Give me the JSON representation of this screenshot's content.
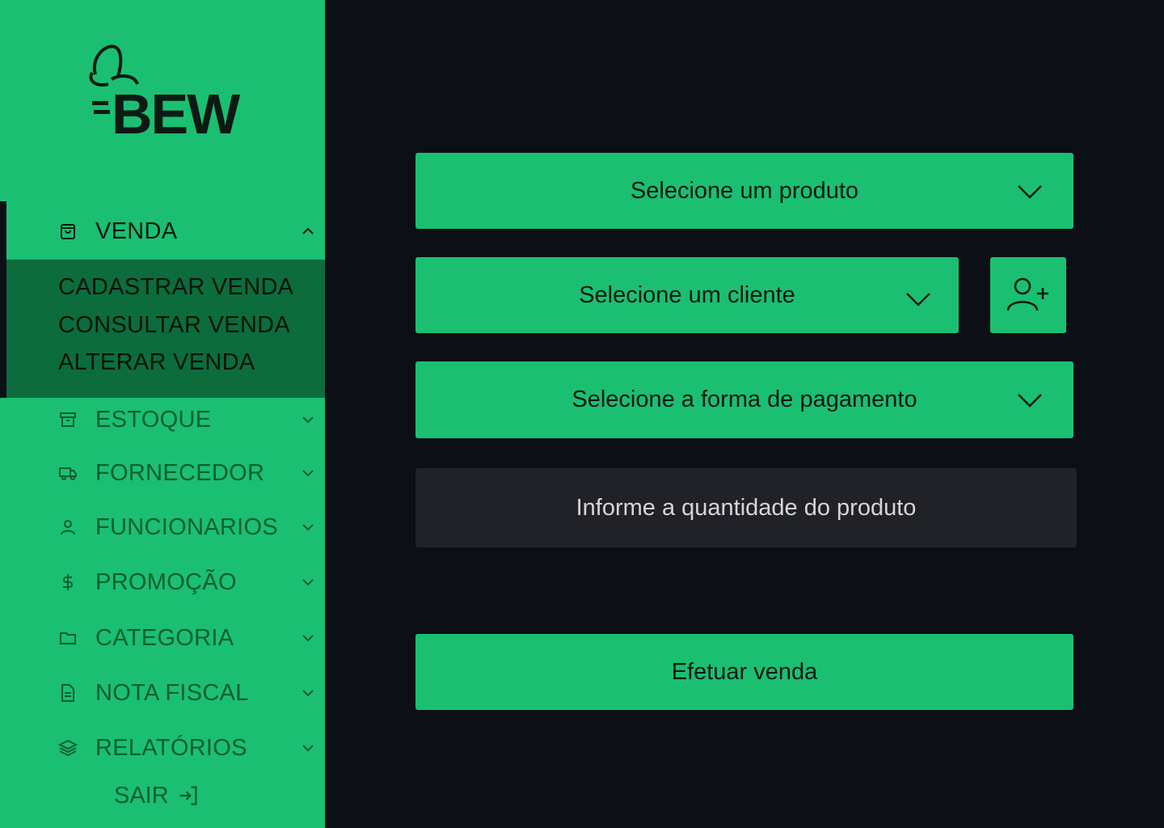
{
  "brand": {
    "name": "BEW"
  },
  "sidebar": {
    "venda": {
      "label": "VENDA",
      "icon": "shopping-bag-icon"
    },
    "submenu": [
      "CADASTRAR VENDA",
      "CONSULTAR VENDA",
      "ALTERAR VENDA"
    ],
    "items": [
      {
        "label": "ESTOQUE",
        "icon": "archive-icon"
      },
      {
        "label": "FORNECEDOR",
        "icon": "truck-icon"
      },
      {
        "label": "FUNCIONARIOS",
        "icon": "user-icon"
      },
      {
        "label": "PROMOÇÃO",
        "icon": "dollar-icon"
      },
      {
        "label": "CATEGORIA",
        "icon": "folder-icon"
      },
      {
        "label": "NOTA FISCAL",
        "icon": "document-icon"
      },
      {
        "label": "RELATÓRIOS",
        "icon": "layers-icon"
      }
    ],
    "logout": {
      "label": "SAIR",
      "icon": "logout-icon"
    }
  },
  "form": {
    "product_select": "Selecione um produto",
    "client_select": "Selecione um cliente",
    "add_client_icon": "add-user-icon",
    "payment_select": "Selecione a forma de pagamento",
    "quantity_placeholder": "Informe a quantidade do produto",
    "submit": "Efetuar venda"
  },
  "colors": {
    "accent": "#1bbf72",
    "submenu_bg": "#0c6c3c",
    "background": "#0d0f17",
    "input_bg": "#202228"
  }
}
